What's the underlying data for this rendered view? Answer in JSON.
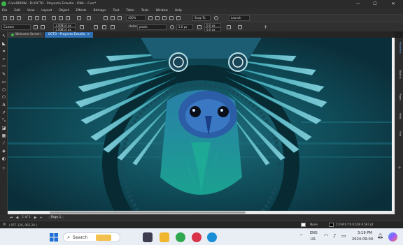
{
  "window": {
    "title": "CorelDRAW - D:\\OCTO - Proyecto Estudio - OWL - Curr*",
    "minimize": "—",
    "maximize": "☐",
    "close": "✕"
  },
  "menu": [
    "File",
    "Edit",
    "View",
    "Layout",
    "Object",
    "Effects",
    "Bitmaps",
    "Text",
    "Table",
    "Tools",
    "Window",
    "Help"
  ],
  "toolbar1": {
    "zoom": "450%",
    "snap": "Snap To",
    "launch": "Launch"
  },
  "toolbar2": {
    "preset": "Custom",
    "width": "1.00814 px",
    "height": "1.00814 px",
    "units_label": "Units:",
    "units": "pixels",
    "nudge": "5.0 px",
    "dup_x": "0.0 px",
    "dup_y": "0.0 px"
  },
  "tabs": [
    {
      "label": "Welcome Screen",
      "active": false
    },
    {
      "label": "OCTO - Proyecto Estudio",
      "active": true
    }
  ],
  "docker_tabs": [
    "Properties",
    "Objects",
    "Pages",
    "Hints",
    "Find"
  ],
  "pagebar": {
    "page_of": "1 of 1",
    "page_name": "Page 1"
  },
  "status": {
    "coords": "( 977.126, 962.20 )",
    "fill": "None",
    "outline": "C:0 M:0 Y:0 K:100 0.567 pt"
  },
  "taskbar": {
    "search_placeholder": "Search",
    "lang1": "ENG",
    "lang2": "US",
    "time": "3:19 PM",
    "date": "2024-09-04"
  },
  "colors": {
    "canvas_bg": "#0e3944",
    "accent": "#2f6fb5"
  }
}
